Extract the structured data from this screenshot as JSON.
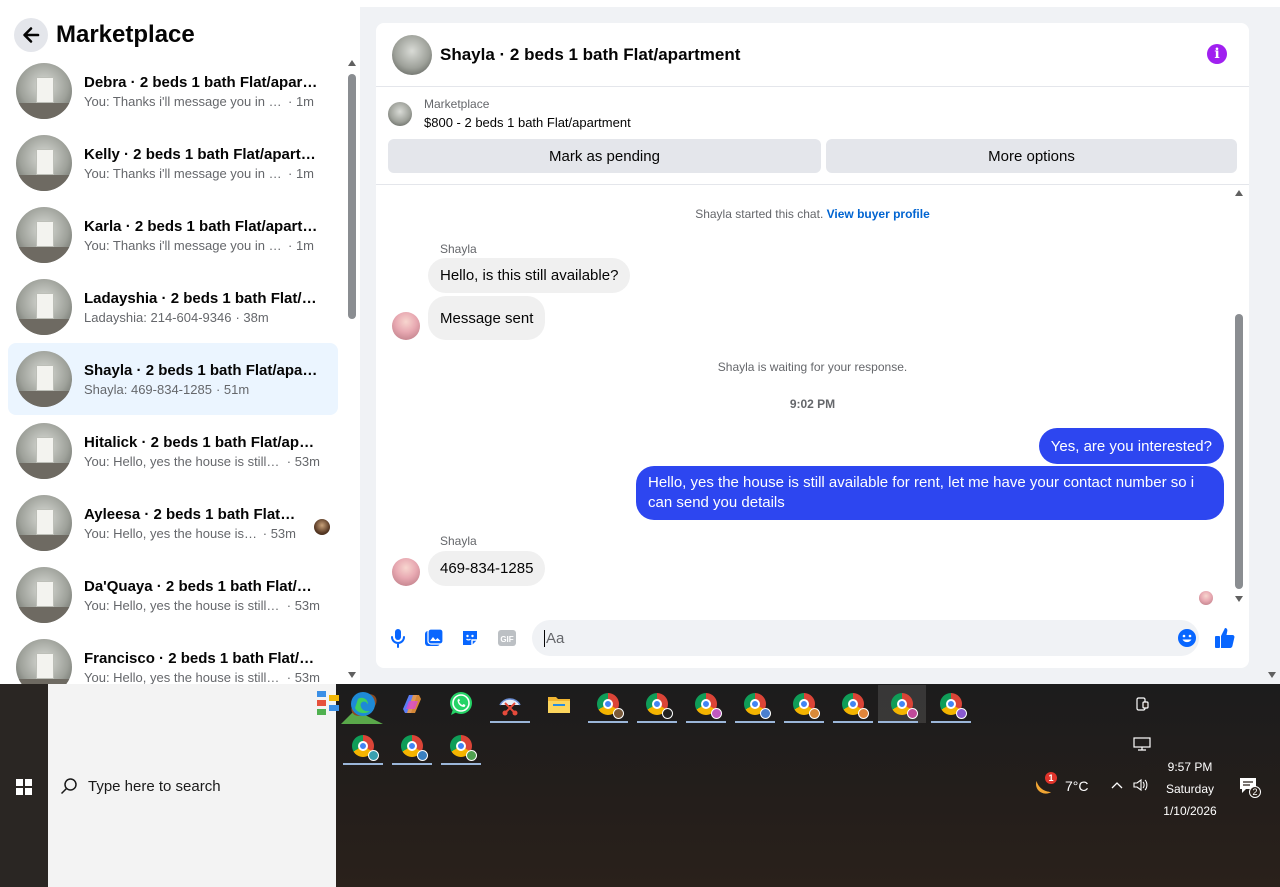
{
  "sidebar": {
    "title": "Marketplace",
    "conversations": [
      {
        "name": "Debra · 2 beds 1 bath Flat/apartment",
        "preview": "You: Thanks i'll message you in a moment",
        "time": "· 1m",
        "active": false
      },
      {
        "name": "Kelly · 2 beds 1 bath Flat/apartment",
        "preview": "You: Thanks i'll message you in a moment",
        "time": "· 1m",
        "active": false
      },
      {
        "name": "Karla · 2 beds 1 bath Flat/apartment",
        "preview": "You: Thanks i'll message you in a moment",
        "time": "· 1m",
        "active": false
      },
      {
        "name": "Ladayshia · 2 beds 1 bath Flat/apartment",
        "preview": "Ladayshia: 214-604-9346",
        "time": "· 38m",
        "active": false
      },
      {
        "name": "Shayla · 2 beds 1 bath Flat/apartment",
        "preview": "Shayla: 469-834-1285",
        "time": "· 51m",
        "active": true
      },
      {
        "name": "Hitalick · 2 beds 1 bath Flat/apartment",
        "preview": "You: Hello, yes the house is still available",
        "time": "· 53m",
        "active": false
      },
      {
        "name": "Ayleesa · 2 beds 1 bath Flat/apartment",
        "preview": "You: Hello, yes the house is still available",
        "time": "· 53m",
        "active": false
      },
      {
        "name": "Da'Quaya · 2 beds 1 bath Flat/apartment",
        "preview": "You: Hello, yes the house is still available",
        "time": "· 53m",
        "active": false
      },
      {
        "name": "Francisco · 2 beds 1 bath Flat/apartment",
        "preview": "You: Hello, yes the house is still available",
        "time": "· 53m",
        "active": false
      }
    ]
  },
  "chat": {
    "title": "Shayla · 2 beds 1 bath Flat/apartment",
    "info_icon": "i",
    "listing": {
      "label": "Marketplace",
      "price_title": "$800 - 2 beds 1 bath Flat/apartment"
    },
    "buttons": {
      "pending": "Mark as pending",
      "options": "More options"
    },
    "started_text": "Shayla started this chat.",
    "buyer_profile_link": "View buyer profile",
    "sender_name": "Shayla",
    "messages": {
      "in1": "Hello, is this still available?",
      "in2": "Message sent",
      "waiting": "Shayla is waiting for your response.",
      "timestamp": "9:02 PM",
      "out1": "Yes, are you interested?",
      "out2": "Hello, yes the house is still available for rent, let me have your contact number so i can send you details",
      "in3": "469-834-1285"
    },
    "composer": {
      "placeholder": "Aa",
      "gif_label": "GIF"
    }
  },
  "taskbar": {
    "search_placeholder": "Type here to search",
    "weather": "7°C",
    "weather_badge": "1",
    "time": "9:57 PM",
    "day": "Saturday",
    "date": "1/10/2026",
    "notifications": "2"
  },
  "colors": {
    "accent": "#0866ff",
    "outgoing_bubble": "#2d46f0",
    "info": "#a020f0"
  }
}
